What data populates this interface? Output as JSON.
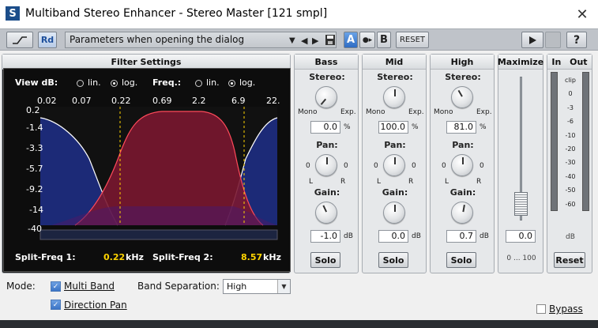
{
  "window": {
    "title": "Multiband Stereo Enhancer - Stereo Master [121 smpl]",
    "icon_letter": "S",
    "close": "✕"
  },
  "toolbar": {
    "rd_label": "Rd",
    "preset": "Parameters when opening the dialog",
    "a_label": "A",
    "ab_copy": "●▸",
    "b_label": "B",
    "reset_label": "RESET",
    "help_label": "?"
  },
  "filter": {
    "header": "Filter Settings",
    "view_db_label": "View dB:",
    "lin_label": "lin.",
    "log_label": "log.",
    "freq_label": "Freq.:",
    "freq_ticks": [
      "0.02",
      "0.07",
      "0.22",
      "0.69",
      "2.2",
      "6.9",
      "22."
    ],
    "db_ticks": [
      "0.2",
      "-1.4",
      "-3.3",
      "-5.7",
      "-9.2",
      "-14",
      "-40"
    ],
    "split1_label": "Split-Freq 1:",
    "split1_value": "0.22",
    "split1_unit": "kHz",
    "split2_label": "Split-Freq 2:",
    "split2_value": "8.57",
    "split2_unit": "kHz",
    "colors": {
      "bass": "#1f2f8a",
      "mid": "#7a1730",
      "high": "#1f2f8a",
      "accent": "#ffd400"
    }
  },
  "bands": [
    {
      "name": "Bass",
      "stereo_label": "Stereo:",
      "mono_label": "Mono",
      "exp_label": "Exp.",
      "stereo_value": "0.0",
      "stereo_unit": "%",
      "pan_label": "Pan:",
      "pan_left": "0",
      "pan_right": "0",
      "l_label": "L",
      "r_label": "R",
      "gain_label": "Gain:",
      "gain_value": "-1.0",
      "gain_unit": "dB",
      "solo_label": "Solo"
    },
    {
      "name": "Mid",
      "stereo_label": "Stereo:",
      "mono_label": "Mono",
      "exp_label": "Exp.",
      "stereo_value": "100.0",
      "stereo_unit": "%",
      "pan_label": "Pan:",
      "pan_left": "0",
      "pan_right": "0",
      "l_label": "L",
      "r_label": "R",
      "gain_label": "Gain:",
      "gain_value": "0.0",
      "gain_unit": "dB",
      "solo_label": "Solo"
    },
    {
      "name": "High",
      "stereo_label": "Stereo:",
      "mono_label": "Mono",
      "exp_label": "Exp.",
      "stereo_value": "81.0",
      "stereo_unit": "%",
      "pan_label": "Pan:",
      "pan_left": "0",
      "pan_right": "0",
      "l_label": "L",
      "r_label": "R",
      "gain_label": "Gain:",
      "gain_value": "0.7",
      "gain_unit": "dB",
      "solo_label": "Solo"
    }
  ],
  "maximize": {
    "header": "Maximize",
    "value": "0.0",
    "range": "0 ... 100"
  },
  "inout": {
    "in_label": "In",
    "out_label": "Out",
    "scale": [
      "clip",
      "0",
      "-3",
      "-6",
      "-10",
      "-20",
      "-30",
      "-40",
      "-50",
      "-60"
    ],
    "unit": "dB",
    "reset_label": "Reset"
  },
  "bottom": {
    "mode_label": "Mode:",
    "multiband_label": "Multi Band",
    "direction_pan_label": "Direction Pan",
    "band_sep_label": "Band Separation:",
    "band_sep_value": "High",
    "bypass_label": "Bypass"
  }
}
